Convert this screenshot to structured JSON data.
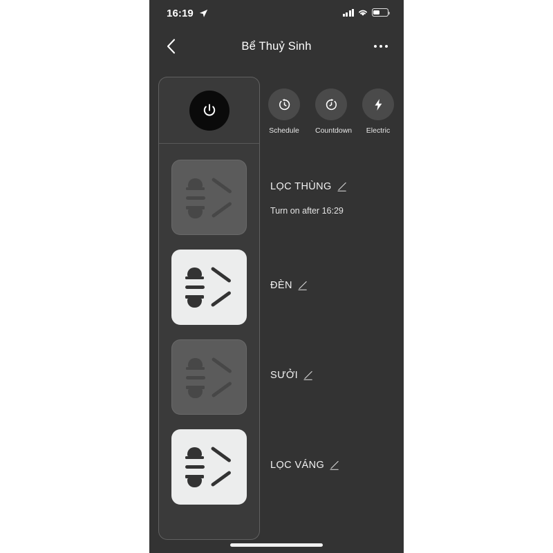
{
  "status_bar": {
    "time": "16:19",
    "location_icon": "location-arrow-icon",
    "signal_icon": "cellular-signal-icon",
    "wifi_icon": "wifi-icon",
    "battery_icon": "battery-icon",
    "battery_level_percent": 45
  },
  "nav": {
    "back_icon": "chevron-left-icon",
    "title": "Bể Thuỷ Sinh",
    "more_icon": "more-horizontal-icon"
  },
  "master": {
    "power_icon": "power-icon",
    "state": "off"
  },
  "actions": [
    {
      "id": "schedule",
      "label": "Schedule",
      "icon": "schedule-timer-icon"
    },
    {
      "id": "countdown",
      "label": "Countdown",
      "icon": "countdown-timer-icon"
    },
    {
      "id": "electric",
      "label": "Electric",
      "icon": "lightning-bolt-icon"
    }
  ],
  "sockets": [
    {
      "name": "LỌC THÙNG",
      "state": "off",
      "status": "Turn on after 16:29",
      "edit_icon": "pencil-edit-icon"
    },
    {
      "name": "ĐÈN",
      "state": "on",
      "status": "",
      "edit_icon": "pencil-edit-icon"
    },
    {
      "name": "SƯỞI",
      "state": "off",
      "status": "",
      "edit_icon": "pencil-edit-icon"
    },
    {
      "name": "LỌC VÁNG",
      "state": "on",
      "status": "",
      "edit_icon": "pencil-edit-icon"
    }
  ],
  "colors": {
    "app_background": "#333333",
    "panel_background": "#3a3a3a",
    "socket_on": "#eceded",
    "socket_off": "#5b5b5b",
    "action_circle": "#4a4a4a",
    "power_button": "#0a0a0a",
    "text_primary": "#ffffff"
  },
  "home_indicator": "home-indicator"
}
